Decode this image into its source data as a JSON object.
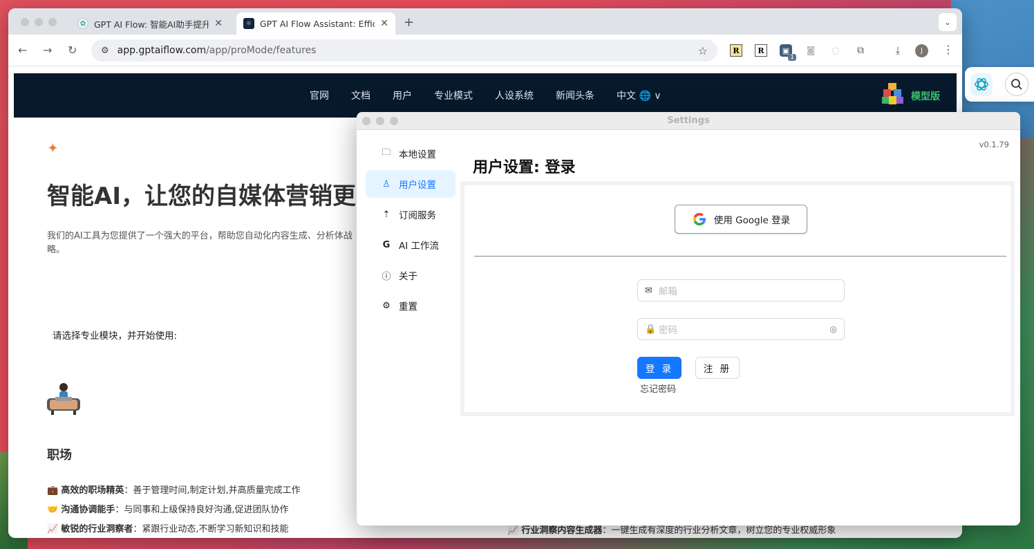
{
  "browser": {
    "tabs": [
      {
        "title": "GPT AI Flow: 智能AI助手提升工作效率",
        "active": false
      },
      {
        "title": "GPT AI Flow Assistant: Efficient AI",
        "active": true
      }
    ],
    "tab_menu_icon": "chevron-down-icon",
    "url_host": "app.gptaiflow.com",
    "url_path": "/app/proMode/features",
    "extensions": [
      "R",
      "R",
      "1"
    ],
    "profile_initial": "J"
  },
  "site": {
    "nav_links": [
      "官网",
      "文档",
      "用户",
      "专业模式",
      "人设系统",
      "新闻头条",
      "中文 🌐 ∨"
    ],
    "model_label": "模型版",
    "hero_title": "智能AI，让您的自媒体营销更",
    "hero_desc": "我们的AI工具为您提供了一个强大的平台，帮助您自动化内容生成、分析体战略。",
    "hero_desc_line2": "体战略。",
    "choose_prompt": "请选择专业模块，并开始使用:",
    "section_title": "职场",
    "features": [
      {
        "emoji": "💼",
        "name": "高效的职场精英",
        "desc": "：善于管理时间,制定计划,并高质量完成工作"
      },
      {
        "emoji": "🤝",
        "name": "沟通协调能手",
        "desc": "：与同事和上级保持良好沟通,促进团队协作"
      },
      {
        "emoji": "📈",
        "name": "敏锐的行业洞察者",
        "desc": "：紧跟行业动态,不断学习新知识和技能"
      }
    ],
    "right_feature": {
      "emoji": "📈",
      "name": "行业洞察内容生成器",
      "desc": "：一键生成有深度的行业分析文章，树立您的专业权威形象"
    }
  },
  "settings": {
    "window_title": "Settings",
    "version": "v0.1.79",
    "menu": [
      {
        "label": "本地设置",
        "icon": "folder-icon",
        "selected": false
      },
      {
        "label": "用户设置",
        "icon": "user-icon",
        "selected": true
      },
      {
        "label": "订阅服务",
        "icon": "rocket-icon",
        "selected": false
      },
      {
        "label": "AI 工作流",
        "icon": "google-g-icon",
        "selected": false
      },
      {
        "label": "关于",
        "icon": "info-icon",
        "selected": false
      },
      {
        "label": "重置",
        "icon": "gear-icon",
        "selected": false
      }
    ],
    "panel_title": "用户设置: 登录",
    "google_button": "使用 Google 登录",
    "email_placeholder": "邮箱",
    "password_placeholder": "密码",
    "login_button": "登 录",
    "register_button": "注 册",
    "forgot_password": "忘记密码"
  }
}
